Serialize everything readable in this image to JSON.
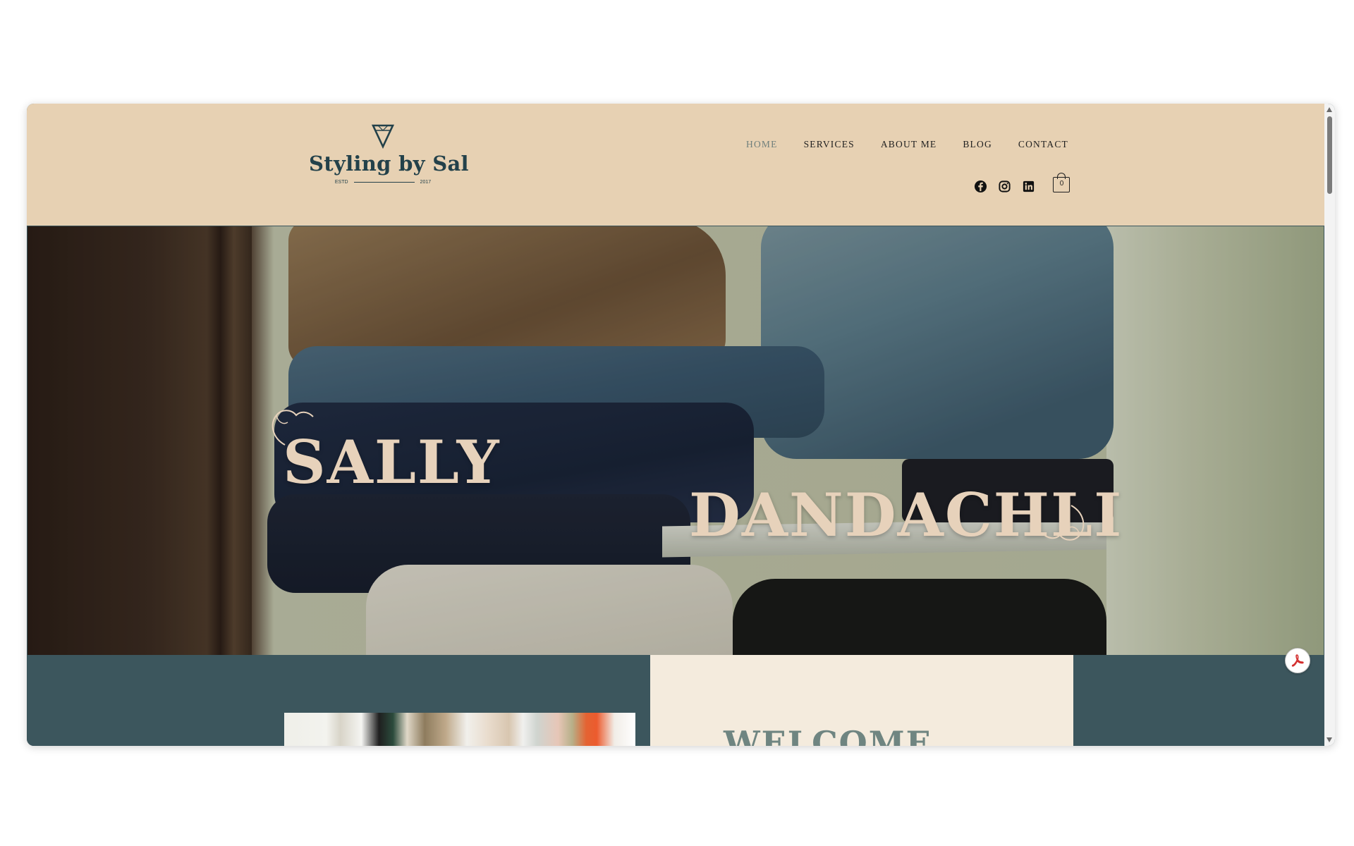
{
  "header": {
    "logo": {
      "brand": "Styling by Sal",
      "estd_label": "ESTD",
      "estd_year": "2017"
    },
    "nav": [
      {
        "label": "HOME",
        "active": true
      },
      {
        "label": "SERVICES",
        "active": false
      },
      {
        "label": "ABOUT ME",
        "active": false
      },
      {
        "label": "BLOG",
        "active": false
      },
      {
        "label": "CONTACT",
        "active": false
      }
    ],
    "social_icons": [
      "facebook-icon",
      "instagram-icon",
      "linkedin-icon"
    ],
    "cart": {
      "count": "0",
      "icon": "shopping-bag-icon"
    }
  },
  "hero": {
    "first_name": "SALLY",
    "last_name": "DANDACHLI"
  },
  "welcome": {
    "heading": "WELCOME"
  },
  "pdf_button": {
    "icon": "adobe-acrobat-icon"
  },
  "colors": {
    "header_bg": "#e7d1b3",
    "brand_teal": "#23414a",
    "section_teal": "#3c565d",
    "card_cream": "#f4ebdd",
    "hero_text": "#e7d2bb"
  }
}
